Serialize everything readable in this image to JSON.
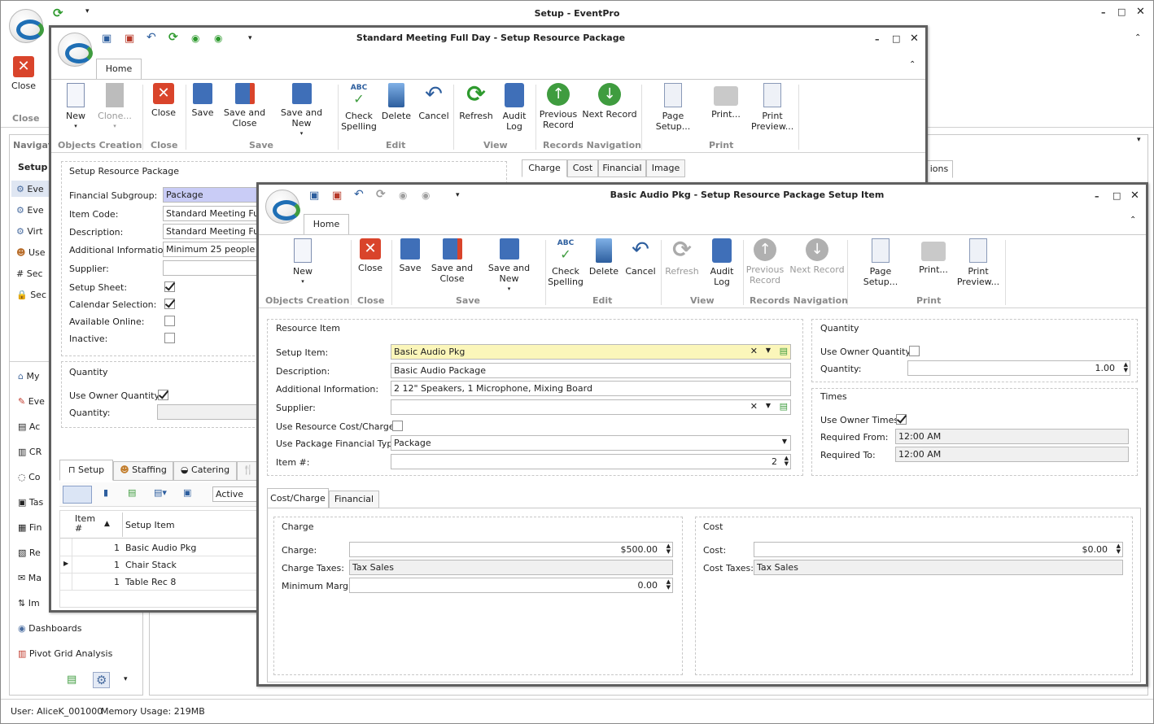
{
  "main_window": {
    "title": "Setup - EventPro",
    "ribbon": {
      "close_label": "Close",
      "close_group": "Close"
    },
    "navigation": {
      "header": "Navigat",
      "setup_label": "Setup",
      "items": [
        "Eve",
        "Eve",
        "Virt",
        "Use",
        "Sec",
        "Sec"
      ],
      "lower_items": [
        "My",
        "Eve",
        "Ac",
        "CR",
        "Co",
        "Tas",
        "Fin",
        "Re",
        "Ma",
        "Im"
      ],
      "dashboards": "Dashboards",
      "pivot": "Pivot Grid Analysis"
    },
    "partial_tab": "ions",
    "status": {
      "user": "User: AliceK_001000",
      "memory": "Memory Usage: 219MB"
    }
  },
  "package_window": {
    "title": "Standard Meeting Full Day - Setup Resource Package",
    "home_tab": "Home",
    "ribbon": {
      "new": "New",
      "clone": "Clone...",
      "close": "Close",
      "save": "Save",
      "save_close": "Save and\nClose",
      "save_new": "Save and New",
      "check": "Check\nSpelling",
      "delete": "Delete",
      "cancel": "Cancel",
      "refresh": "Refresh",
      "audit": "Audit\nLog",
      "prev": "Previous\nRecord",
      "next": "Next Record",
      "page_setup": "Page Setup...",
      "print": "Print...",
      "print_preview": "Print\nPreview...",
      "groups": {
        "objects": "Objects Creation",
        "close": "Close",
        "save": "Save",
        "edit": "Edit",
        "view": "View",
        "nav": "Records Navigation",
        "print": "Print"
      }
    },
    "section_title": "Setup Resource Package",
    "fields": {
      "financial_subgroup_label": "Financial Subgroup:",
      "financial_subgroup": "Package",
      "item_code_label": "Item Code:",
      "item_code": "Standard Meeting Full D",
      "description_label": "Description:",
      "description": "Standard Meeting Full D",
      "additional_label": "Additional Information:",
      "additional": "Minimum 25 people",
      "supplier_label": "Supplier:",
      "setup_sheet_label": "Setup Sheet:",
      "calendar_label": "Calendar Selection:",
      "online_label": "Available Online:",
      "inactive_label": "Inactive:"
    },
    "quantity": {
      "title": "Quantity",
      "use_owner_label": "Use Owner Quantity:",
      "quantity_label": "Quantity:"
    },
    "right_tabs": [
      "Charge",
      "Cost",
      "Financial",
      "Image"
    ],
    "bottom_tabs": [
      "Setup",
      "Staffing",
      "Catering",
      "🍴"
    ],
    "filter_value": "Active",
    "grid": {
      "headers": [
        "Item\n#",
        "Setup Item"
      ],
      "rows": [
        {
          "num": "1",
          "item": "Basic Audio Pkg"
        },
        {
          "num": "1",
          "item": "Chair Stack"
        },
        {
          "num": "1",
          "item": "Table Rec 8"
        }
      ]
    }
  },
  "item_window": {
    "title": "Basic Audio Pkg - Setup Resource Package Setup Item",
    "home_tab": "Home",
    "ribbon": {
      "new": "New",
      "close": "Close",
      "save": "Save",
      "save_close": "Save and\nClose",
      "save_new": "Save and New",
      "check": "Check\nSpelling",
      "delete": "Delete",
      "cancel": "Cancel",
      "refresh": "Refresh",
      "audit": "Audit\nLog",
      "prev": "Previous\nRecord",
      "next": "Next Record",
      "page_setup": "Page Setup...",
      "print": "Print...",
      "print_preview": "Print\nPreview...",
      "groups": {
        "objects": "Objects Creation",
        "close": "Close",
        "save": "Save",
        "edit": "Edit",
        "view": "View",
        "nav": "Records Navigation",
        "print": "Print"
      }
    },
    "resource": {
      "title": "Resource Item",
      "setup_item_label": "Setup Item:",
      "setup_item": "Basic Audio Pkg",
      "description_label": "Description:",
      "description": "Basic Audio Package",
      "additional_label": "Additional Information:",
      "additional": "2 12\" Speakers, 1 Microphone, Mixing Board",
      "supplier_label": "Supplier:",
      "use_cost_label": "Use Resource Cost/Charge:",
      "use_fin_label": "Use Package Financial Type:",
      "use_fin": "Package",
      "item_num_label": "Item #:",
      "item_num": "2"
    },
    "quantity": {
      "title": "Quantity",
      "use_owner_label": "Use Owner Quantity:",
      "quantity_label": "Quantity:",
      "quantity": "1.00"
    },
    "times": {
      "title": "Times",
      "use_owner_label": "Use Owner Times:",
      "from_label": "Required From:",
      "from": "12:00 AM",
      "to_label": "Required To:",
      "to": "12:00 AM"
    },
    "tabs": [
      "Cost/Charge",
      "Financial"
    ],
    "charge": {
      "title": "Charge",
      "charge_label": "Charge:",
      "charge": "$500.00",
      "taxes_label": "Charge Taxes:",
      "taxes": "Tax Sales",
      "margin_label": "Minimum Margin:",
      "margin": "0.00"
    },
    "cost": {
      "title": "Cost",
      "cost_label": "Cost:",
      "cost": "$0.00",
      "taxes_label": "Cost Taxes:",
      "taxes": "Tax Sales"
    }
  }
}
